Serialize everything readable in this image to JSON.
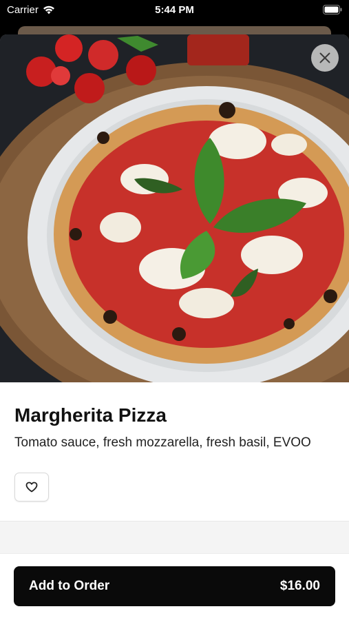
{
  "status_bar": {
    "carrier": "Carrier",
    "time": "5:44 PM"
  },
  "item": {
    "name": "Margherita Pizza",
    "description": "Tomato sauce, fresh mozzarella, fresh basil, EVOO",
    "image_alt": "Margherita pizza photo"
  },
  "order_button": {
    "label": "Add to Order",
    "price": "$16.00"
  },
  "icons": {
    "close": "close-icon",
    "favorite": "heart-icon",
    "wifi": "wifi-icon",
    "battery": "battery-icon"
  },
  "colors": {
    "button_bg": "#0a0a0a",
    "sheet_bg": "#ffffff",
    "status_bg": "#000000"
  }
}
